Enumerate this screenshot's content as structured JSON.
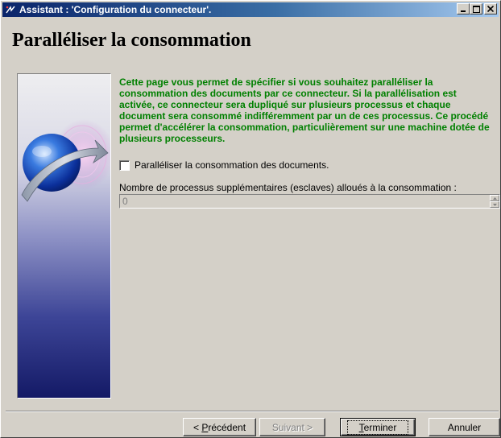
{
  "window": {
    "title": "Assistant : 'Configuration du connecteur'.",
    "minimize_symbol": "_",
    "maximize_symbol": "□",
    "close_symbol": "×"
  },
  "page": {
    "title": "Paralléliser la consommation",
    "description": "Cette page vous permet de spécifier si vous souhaitez paralléliser la consommation des documents par ce connecteur. Si la parallélisation est activée, ce connecteur sera dupliqué sur plusieurs processus et chaque document sera consommé indifféremment par un de ces processus. Ce procédé permet d'accélérer la consommation, particulièrement sur une machine dotée de plusieurs processeurs.",
    "description_color": "#008000"
  },
  "options": {
    "parallelize_label": "Paralléliser la consommation des documents.",
    "parallelize_checked": false,
    "slaves_label": "Nombre de processus supplémentaires (esclaves) alloués à la consommation :",
    "slaves_value": "0",
    "slaves_enabled": false
  },
  "buttons": {
    "previous_prefix": "< ",
    "previous_mnemonic": "P",
    "previous_rest": "récédent",
    "next_label": "Suivant >",
    "finish_mnemonic": "T",
    "finish_rest": "erminer",
    "cancel_label": "Annuler"
  },
  "colors": {
    "titlebar_start": "#0a246a",
    "titlebar_end": "#a6caf0",
    "dialog_face": "#d4d0c8",
    "side_panel_top": "#e8e8ea",
    "side_panel_bottom": "#1a1f6e"
  },
  "icons": {
    "app": "connector-app-icon",
    "side_image": "globe-arrow-illustration"
  }
}
